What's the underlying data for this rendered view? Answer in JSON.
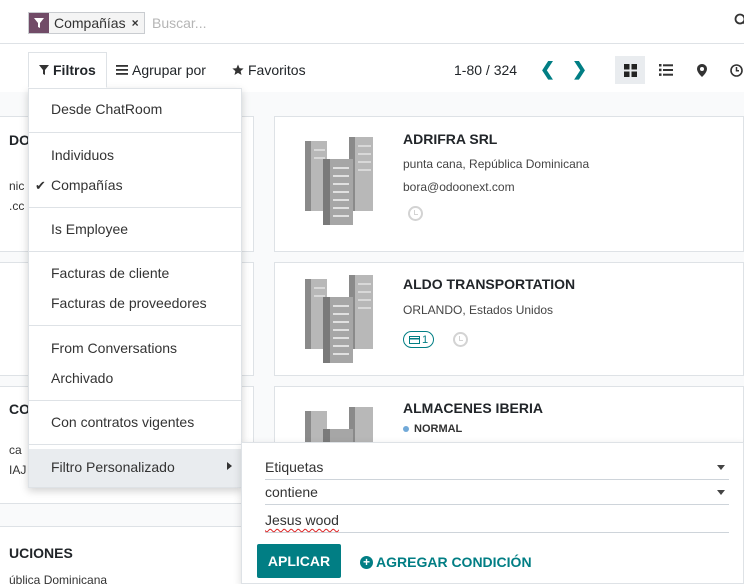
{
  "search": {
    "facet_label": "Compañías",
    "facet_remove": "×",
    "placeholder": "Buscar..."
  },
  "controls": {
    "filters_label": "Filtros",
    "group_by_label": "Agrupar por",
    "favorites_label": "Favoritos",
    "pager_value": "1-80 / 324",
    "prev": "❮",
    "next": "❯"
  },
  "filter_menu": {
    "items": [
      "Desde ChatRoom",
      "Individuos",
      "Compañías",
      "Is Employee",
      "Facturas de cliente",
      "Facturas de proveedores",
      "From Conversations",
      "Archivado",
      "Con contratos vigentes"
    ],
    "checked_item": "Compañías",
    "check_mark": "✔",
    "custom_filter_label": "Filtro Personalizado"
  },
  "custom_filter": {
    "field": "Etiquetas",
    "operator": "contiene",
    "value": "Jesus wood",
    "apply_label": "APLICAR",
    "add_condition_label": "AGREGAR CONDICIÓN",
    "plus": "+"
  },
  "cards": [
    {
      "name": "ADRIFRA SRL",
      "location": "punta cana, República Dominicana",
      "email": "bora@odoonext.com"
    },
    {
      "name": "ALDO TRANSPORTATION",
      "location": "ORLANDO, Estados Unidos",
      "badge_count": "1"
    },
    {
      "name": "ALMACENES IBERIA",
      "status": "NORMAL"
    }
  ],
  "left_fragments": {
    "f1": "DO",
    "f2": "nic",
    "f3": ".cc",
    "f4": "CO",
    "f5": "ca",
    "f6": "IAJ",
    "f7": "UCIONES",
    "f8": "ública Dominicana"
  },
  "colors": {
    "accent": "#017e84",
    "brand": "#714b67"
  }
}
